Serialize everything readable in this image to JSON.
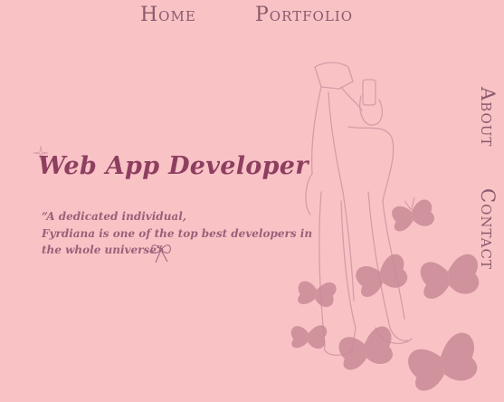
{
  "nav": {
    "home": "Home",
    "portfolio": "Portfolio",
    "about": "About",
    "contact": "Contact"
  },
  "hero": {
    "title": "Web App Developer",
    "quote_line1": "“A dedicated individual,",
    "quote_line2": "Fyrdiana is one of the top best developers in",
    "quote_line3": "the whole universe”"
  },
  "colors": {
    "background": "#f9c3c6",
    "accent": "#8e3f60",
    "butterfly": "#c98a97"
  },
  "icons": [
    "bow-icon",
    "sparkle-icon",
    "butterfly-icon",
    "person-taking-selfie-illustration"
  ]
}
